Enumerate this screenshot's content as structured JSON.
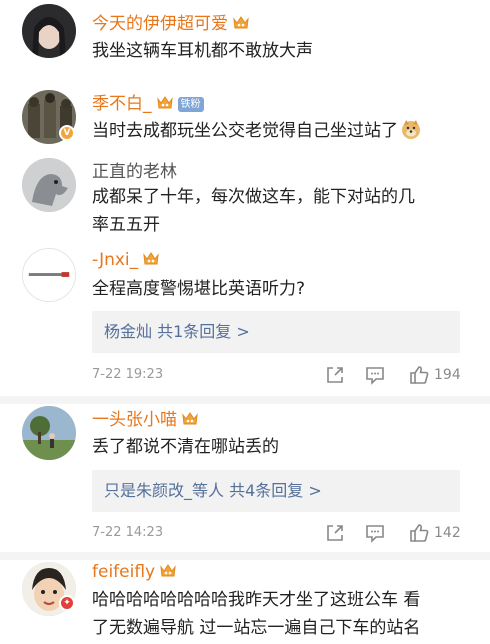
{
  "comments": [
    {
      "username": "今天的伊伊超可爱",
      "text": "我坐这辆车耳机都不敢放大声"
    },
    {
      "username": "季不白_",
      "badge": "铁粉",
      "text": "当时去成都玩坐公交老觉得自己坐过站了"
    },
    {
      "username": "正直的老林",
      "text_line1": "成都呆了十年，每次做这车，能下对站的几",
      "text_line2": "率五五开"
    },
    {
      "username": "-Jnxi_",
      "text": "全程高度警惕堪比英语听力?",
      "reply_summary": "杨金灿  共1条回复 >",
      "time": "7-22 19:23",
      "like_count": "194"
    },
    {
      "username": "一头张小喵",
      "text": "丢了都说不清在哪站丢的",
      "reply_summary": "只是朱颜改_等人  共4条回复 >",
      "time": "7-22 14:23",
      "like_count": "142"
    },
    {
      "username": "feifeifly",
      "text_line1": "哈哈哈哈哈哈哈哈我昨天才坐了这班公车 看",
      "text_line2": "了无数遍导航 过一站忘一遍自己下车的站名"
    }
  ],
  "icons": {
    "crown": "fan-crown-icon",
    "share": "share-icon",
    "comment": "comment-icon",
    "like": "thumbs-up-icon",
    "emoji": "doge-emoji"
  },
  "colors": {
    "username": "#e8771c",
    "plain_username": "#555555",
    "reply_link": "#55709b",
    "meta": "#9a9a9a"
  }
}
